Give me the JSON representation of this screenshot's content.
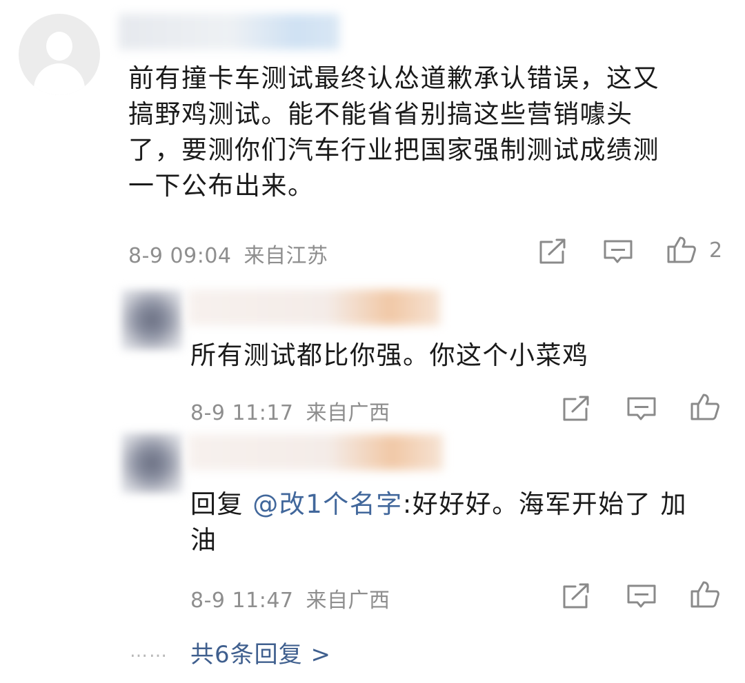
{
  "comment": {
    "text_lines": [
      "前有撞卡车测试最终认怂道歉承认错误，这又",
      "搞野鸡测试。能不能省省别搞这些营销噱头",
      "了，要测你们汽车行业把国家强制测试成绩测",
      "一下公布出来。"
    ],
    "time": "8-9 09:04",
    "location": "来自江苏",
    "like_count": "2",
    "icons": [
      "share-icon",
      "comment-icon",
      "like-icon"
    ]
  },
  "replies": [
    {
      "text_lines": [
        "所有测试都比你强。你这个小菜鸡"
      ],
      "time": "8-9 11:17",
      "location": "来自广西"
    },
    {
      "reply_prefix": "回复",
      "mention": "@改1个名字",
      "text_after_mention": ":好好好。海军开始了 加",
      "text_line2": "油",
      "time": "8-9 11:47",
      "location": "来自广西"
    }
  ],
  "more": {
    "dots": "……",
    "label": "共6条回复 >"
  },
  "colors": {
    "text": "#1a1a1a",
    "meta": "#8e8e8e",
    "link": "#3f5f8e",
    "icon": "#8a8a8a"
  }
}
